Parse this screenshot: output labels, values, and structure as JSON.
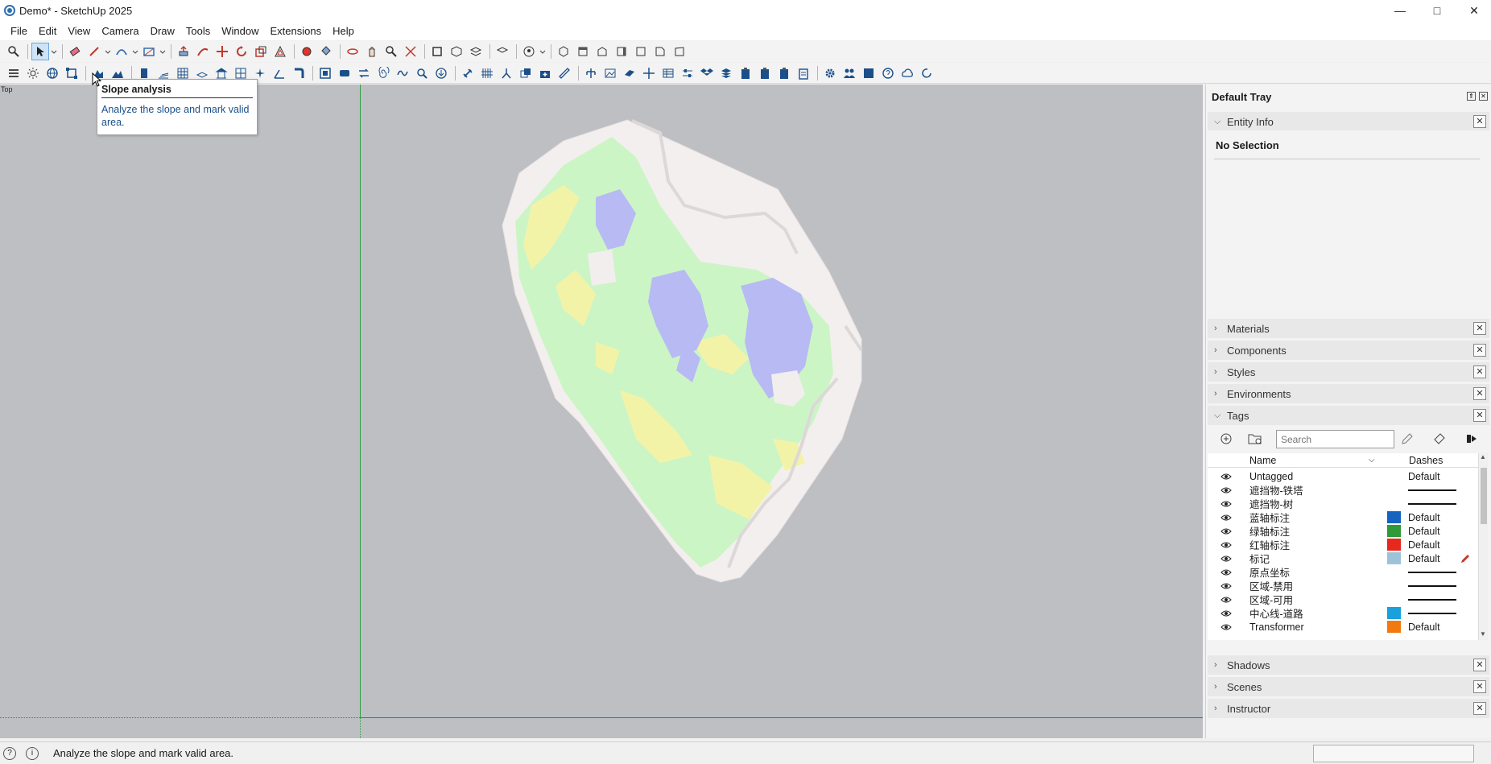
{
  "window": {
    "title": "Demo* - SketchUp 2025",
    "controls": [
      "minimize-icon",
      "maximize-icon",
      "close-icon"
    ]
  },
  "menu": [
    "File",
    "Edit",
    "View",
    "Camera",
    "Draw",
    "Tools",
    "Window",
    "Extensions",
    "Help"
  ],
  "viewport": {
    "view_label": "Top"
  },
  "tooltip": {
    "title": "Slope analysis",
    "body": "Analyze the slope and mark valid area."
  },
  "tray": {
    "title": "Default Tray",
    "entity_info": {
      "label": "Entity Info",
      "status": "No Selection"
    },
    "panels": {
      "materials": "Materials",
      "components": "Components",
      "styles": "Styles",
      "environments": "Environments",
      "tags": "Tags",
      "shadows": "Shadows",
      "scenes": "Scenes",
      "instructor": "Instructor"
    }
  },
  "tags": {
    "search_placeholder": "Search",
    "headers": {
      "name": "Name",
      "dashes": "Dashes"
    },
    "rows": [
      {
        "name": "Untagged",
        "color": "",
        "dashes": "Default"
      },
      {
        "name": "遮挡物-铁塔",
        "color": "",
        "dashes": "solid-line"
      },
      {
        "name": "遮挡物-树",
        "color": "",
        "dashes": "solid-line"
      },
      {
        "name": "蓝轴标注",
        "color": "#1565c0",
        "dashes": "Default"
      },
      {
        "name": "绿轴标注",
        "color": "#2e9a3a",
        "dashes": "Default"
      },
      {
        "name": "红轴标注",
        "color": "#e8281e",
        "dashes": "Default"
      },
      {
        "name": "标记",
        "color": "#9dc3d9",
        "dashes": "Default",
        "active": true
      },
      {
        "name": "原点坐标",
        "color": "",
        "dashes": "solid-line"
      },
      {
        "name": "区域-禁用",
        "color": "",
        "dashes": "solid-line"
      },
      {
        "name": "区域-可用",
        "color": "",
        "dashes": "solid-line"
      },
      {
        "name": "中心线-道路",
        "color": "#1aa0dc",
        "dashes": "solid-line"
      },
      {
        "name": "Transformer",
        "color": "#f07a10",
        "dashes": "Default"
      }
    ]
  },
  "status": {
    "text": "Analyze the slope and mark valid area."
  },
  "colors": {
    "viewport_bg": "#bebfc3",
    "green_axis": "#2ea043",
    "red_axis": "#e0342a",
    "terrain_green": "#c9f5c4",
    "terrain_yellow": "#f5f5a6",
    "terrain_blue": "#b6b8f3",
    "terrain_base": "#f3eeee"
  }
}
